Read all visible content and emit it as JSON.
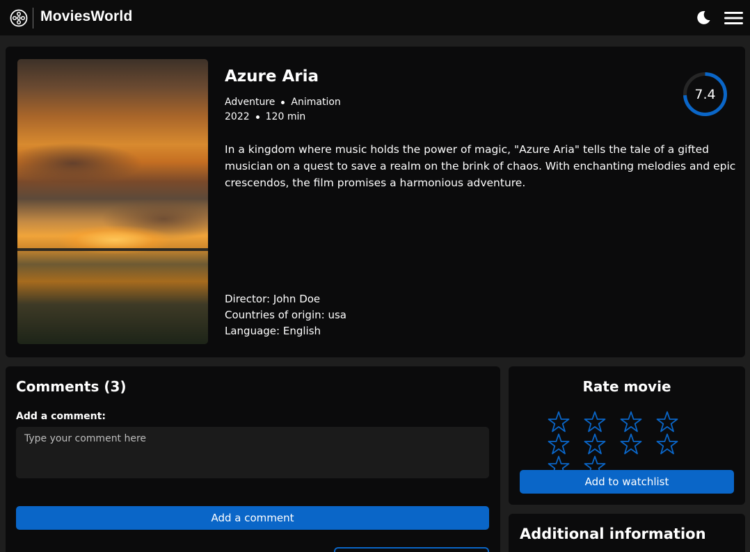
{
  "header": {
    "brand": "MoviesWorld",
    "logo_icon": "film-reel-icon",
    "theme_icon": "moon-icon",
    "menu_icon": "hamburger-menu-icon"
  },
  "movie": {
    "title": "Azure Aria",
    "genres": [
      "Adventure",
      "Animation"
    ],
    "year": "2022",
    "duration": "120 min",
    "rating": "7.4",
    "rating_fraction": 0.74,
    "description": "In a kingdom where music holds the power of magic, \"Azure Aria\" tells the tale of a gifted musician on a quest to save a realm on the brink of chaos. With enchanting melodies and epic crescendos, the film promises a harmonious adventure.",
    "director": "Director: John Doe",
    "countries": "Countries of origin: usa",
    "language": "Language: English"
  },
  "comments": {
    "title": "Comments (3)",
    "add_label": "Add a comment:",
    "placeholder": "Type your comment here",
    "add_button": "Add a comment"
  },
  "rate": {
    "title": "Rate movie",
    "stars_total": 10,
    "stars_selected": 0,
    "watchlist_button": "Add to watchlist"
  },
  "additional": {
    "title": "Additional information"
  },
  "colors": {
    "accent": "#0a66c8",
    "background": "#1e1e1e",
    "card": "#0b0b0c"
  }
}
